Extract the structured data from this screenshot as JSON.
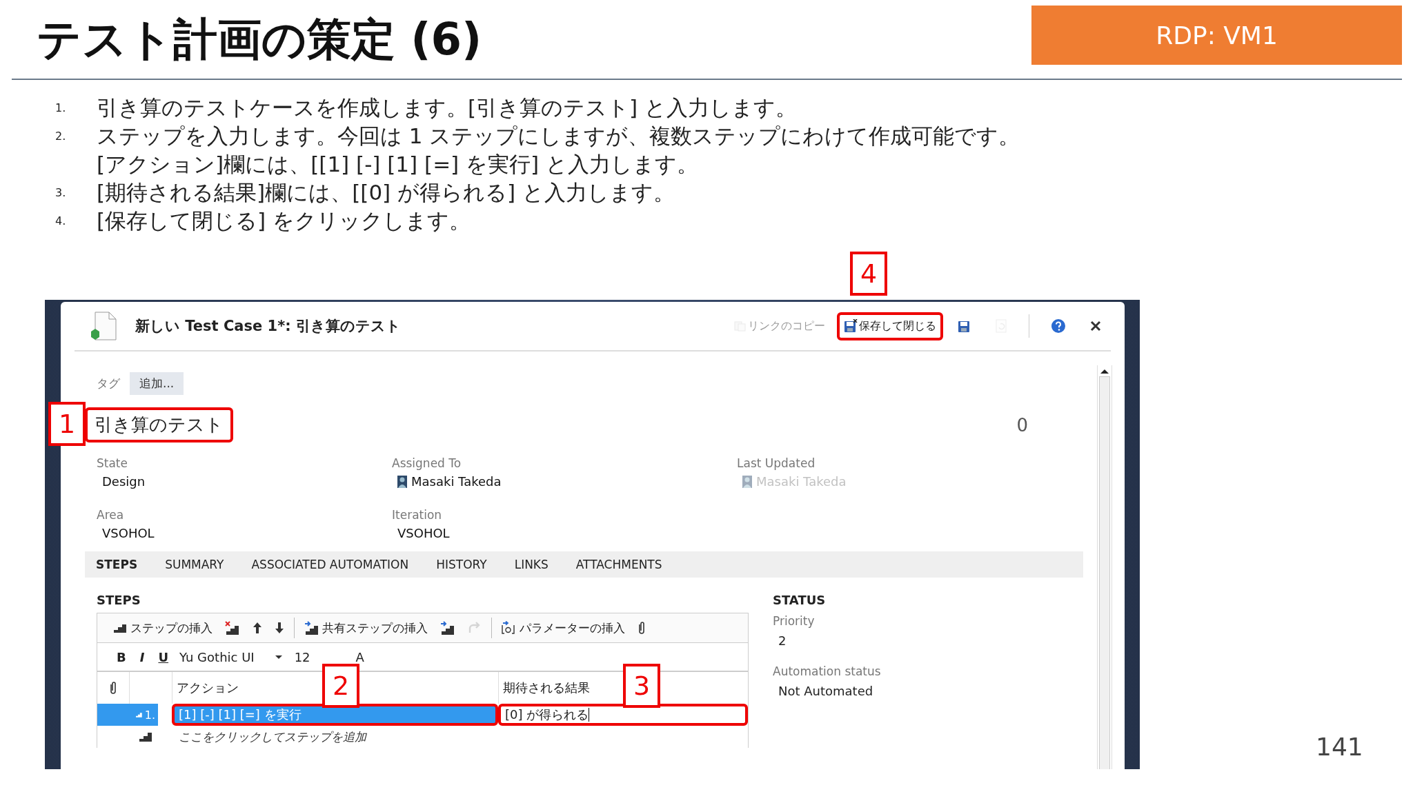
{
  "slide": {
    "title": "テスト計画の策定 (6)",
    "badge": "RDP: VM1",
    "page_number": "141"
  },
  "instructions": [
    {
      "number": "1.",
      "lines": [
        "引き算のテストケースを作成します。[引き算のテスト] と入力します。"
      ]
    },
    {
      "number": "2.",
      "lines": [
        "ステップを入力します。今回は 1 ステップにしますが、複数ステップにわけて作成可能です。",
        "[アクション]欄には、[[1] [-] [1] [=] を実行] と入力します。"
      ]
    },
    {
      "number": "3.",
      "lines": [
        "[期待される結果]欄には、[[0] が得られる] と入力します。"
      ]
    },
    {
      "number": "4.",
      "lines": [
        "[保存して閉じる] をクリックします。"
      ]
    }
  ],
  "window": {
    "title": "新しい Test Case 1*: 引き算のテスト",
    "toolbar": [
      {
        "kind": "copy-link",
        "label": "リンクのコピー",
        "disabled": true
      },
      {
        "kind": "save-close",
        "label": "保存して閉じる",
        "disabled": false,
        "highlighted": true
      },
      {
        "kind": "save",
        "disabled": false
      },
      {
        "kind": "refresh",
        "disabled": true
      },
      {
        "kind": "help",
        "disabled": false
      },
      {
        "kind": "close",
        "disabled": false
      }
    ]
  },
  "tags": {
    "label": "タグ",
    "add_button": "追加..."
  },
  "work_item": {
    "title": "引き算のテスト",
    "id": "0",
    "highlighted": true
  },
  "fields": [
    {
      "label": "State",
      "value": "Design",
      "kind": "text",
      "disabled": false
    },
    {
      "label": "Assigned To",
      "value": "Masaki Takeda",
      "kind": "person",
      "disabled": false
    },
    {
      "label": "Last Updated",
      "value": "Masaki Takeda",
      "kind": "person",
      "disabled": true
    },
    {
      "label": "Area",
      "value": "VSOHOL",
      "kind": "text",
      "disabled": false
    },
    {
      "label": "Iteration",
      "value": "VSOHOL",
      "kind": "text",
      "disabled": false
    }
  ],
  "tabs": [
    {
      "label": "STEPS",
      "selected": true
    },
    {
      "label": "SUMMARY",
      "selected": false
    },
    {
      "label": "ASSOCIATED AUTOMATION",
      "selected": false
    },
    {
      "label": "HISTORY",
      "selected": false
    },
    {
      "label": "LINKS",
      "selected": false
    },
    {
      "label": "ATTACHMENTS",
      "selected": false
    }
  ],
  "steps": {
    "heading": "STEPS",
    "toolbar_groups": [
      [
        {
          "kind": "insert-step",
          "label": "ステップの挿入",
          "disabled": false
        },
        {
          "kind": "delete-step",
          "disabled": false
        },
        {
          "kind": "move-up",
          "disabled": false
        },
        {
          "kind": "move-down",
          "disabled": false
        }
      ],
      [
        {
          "kind": "insert-shared",
          "label": "共有ステップの挿入",
          "disabled": false
        },
        {
          "kind": "create-shared",
          "disabled": false
        },
        {
          "kind": "redo",
          "disabled": true
        }
      ],
      [
        {
          "kind": "insert-parameter",
          "label": "パラメーターの挿入",
          "disabled": false
        },
        {
          "kind": "attach",
          "disabled": false
        }
      ]
    ],
    "format_buttons": [
      {
        "label": "B",
        "kind": "bold"
      },
      {
        "label": "I",
        "kind": "italic"
      },
      {
        "label": "U",
        "kind": "underline"
      }
    ],
    "font": "Yu Gothic UI",
    "font_size": "12",
    "font_color": "A",
    "columns": [
      "アクション",
      "期待される結果"
    ],
    "rows": [
      {
        "number": "1.",
        "action": "[1] [-] [1] [=] を実行",
        "expected": "[0] が得られる",
        "selected": true,
        "action_highlighted": true,
        "expected_highlighted": true
      }
    ],
    "add_hint": "ここをクリックしてステップを追加"
  },
  "status": {
    "heading": "STATUS",
    "fields": [
      {
        "label": "Priority",
        "value": "2"
      },
      {
        "label": "Automation status",
        "value": "Not Automated"
      }
    ]
  },
  "callouts": [
    "1",
    "2",
    "3",
    "4"
  ]
}
